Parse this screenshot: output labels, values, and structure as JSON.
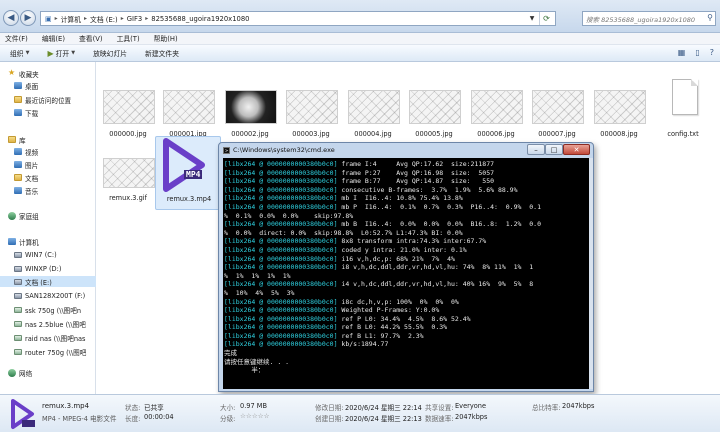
{
  "address": {
    "crumbs": [
      "计算机",
      "文档 (E:)",
      "GIF3",
      "82535688_ugoira1920x1080"
    ],
    "search_placeholder": "搜索 82535688_ugoira1920x1080"
  },
  "menu": [
    "文件(F)",
    "编辑(E)",
    "查看(V)",
    "工具(T)",
    "帮助(H)"
  ],
  "toolbar": {
    "organize": "组织",
    "open": "打开",
    "slideshow": "放映幻灯片",
    "new_folder": "新建文件夹"
  },
  "sidebar": {
    "favorites": "收藏夹",
    "favorites_items": [
      "桌面",
      "最近访问的位置",
      "下载"
    ],
    "libraries": "库",
    "library_items": [
      "视频",
      "图片",
      "文档",
      "音乐"
    ],
    "homegroup": "家庭组",
    "computer": "计算机",
    "drives": [
      "WIN7 (C:)",
      "WINXP (D:)",
      "文档 (E:)",
      "SAN128X200T (F:)",
      "ssk 750g (\\\\图吧n",
      "nas 2.5blue (\\\\图吧",
      "raid nas (\\\\图吧nas",
      "router 750g (\\\\图吧"
    ],
    "network": "网络"
  },
  "files": {
    "images": [
      "000000.jpg",
      "000001.jpg",
      "000002.jpg",
      "000003.jpg",
      "000004.jpg",
      "000005.jpg",
      "000006.jpg",
      "000007.jpg",
      "000008.jpg"
    ],
    "config": "config.txt",
    "gif": "remux.3.gif",
    "mp4": "remux.3.mp4",
    "mp4_badge": "MP4"
  },
  "cmd": {
    "title": "C:\\Windows\\system32\\cmd.exe",
    "min": "–",
    "max": "□",
    "close": "✕",
    "prefix": "[libx264 @ 0000000000380b0c0]",
    "lines": [
      {
        "p": true,
        "t": " frame I:4     Avg QP:17.62  size:211877"
      },
      {
        "p": true,
        "t": " frame P:27    Avg QP:16.98  size:  5057"
      },
      {
        "p": true,
        "t": " frame B:77    Avg QP:14.87  size:   550"
      },
      {
        "p": true,
        "t": " consecutive B-frames:  3.7%  1.9%  5.6% 88.9%"
      },
      {
        "p": true,
        "t": " mb I  I16..4: 10.8% 75.4% 13.8%"
      },
      {
        "p": true,
        "t": " mb P  I16..4:  0.1%  0.7%  0.3%  P16..4:  0.9%  0.1"
      },
      {
        "p": false,
        "t": "%  0.1%  0.0%  0.0%    skip:97.8%"
      },
      {
        "p": true,
        "t": " mb B  I16..4:  0.0%  0.0%  0.0%  B16..8:  1.2%  0.0"
      },
      {
        "p": false,
        "t": "%  0.0%  direct: 0.0%  skip:98.8%  L0:52.7% L1:47.3% BI: 0.0%"
      },
      {
        "p": true,
        "t": " 8x8 transform intra:74.3% inter:67.7%"
      },
      {
        "p": true,
        "t": " coded y intra: 21.0% inter: 0.1%"
      },
      {
        "p": true,
        "t": " i16 v,h,dc,p: 68% 21%  7%  4%"
      },
      {
        "p": true,
        "t": " i8 v,h,dc,ddl,ddr,vr,hd,vl,hu: 74%  8% 11%  1%  1"
      },
      {
        "p": false,
        "t": "%  1%  1%  1%  1%"
      },
      {
        "p": true,
        "t": " i4 v,h,dc,ddl,ddr,vr,hd,vl,hu: 40% 16%  9%  5%  8"
      },
      {
        "p": false,
        "t": "%  10%  4%  5%  3%"
      },
      {
        "p": true,
        "t": " i8c dc,h,v,p: 100%  0%  0%  0%"
      },
      {
        "p": true,
        "t": " Weighted P-Frames: Y:0.0%"
      },
      {
        "p": true,
        "t": " ref P L0: 34.4%  4.5%  8.6% 52.4%"
      },
      {
        "p": true,
        "t": " ref B L0: 44.2% 55.5%  0.3%"
      },
      {
        "p": true,
        "t": " ref B L1: 97.7%  2.3%"
      },
      {
        "p": true,
        "t": " kb/s:1894.77"
      },
      {
        "p": false,
        "t": "完成"
      },
      {
        "p": false,
        "t": "请按任意键继续. . ."
      },
      {
        "p": false,
        "t": "       半："
      }
    ]
  },
  "details": {
    "name": "remux.3.mp4",
    "type": "MP4 - MPEG-4 电影文件",
    "status_key": "状态:",
    "status_val": "已共享",
    "duration_key": "长度:",
    "duration_val": "00:00:04",
    "size_key": "大小:",
    "size_val": "0.97 MB",
    "rating_key": "分级:",
    "rating_val": "☆☆☆☆☆",
    "modified_key": "修改日期:",
    "modified_val": "2020/6/24 星期三 22:14",
    "created_key": "创建日期:",
    "created_val": "2020/6/24 星期三 22:13",
    "shared_key": "共享设置:",
    "shared_val": "Everyone",
    "rate_key": "数据速率:",
    "rate_val": "",
    "bitrate_key": "总比特率:",
    "bitrate_val": "2047kbps",
    "bitrate2_val": "2047kbps"
  }
}
